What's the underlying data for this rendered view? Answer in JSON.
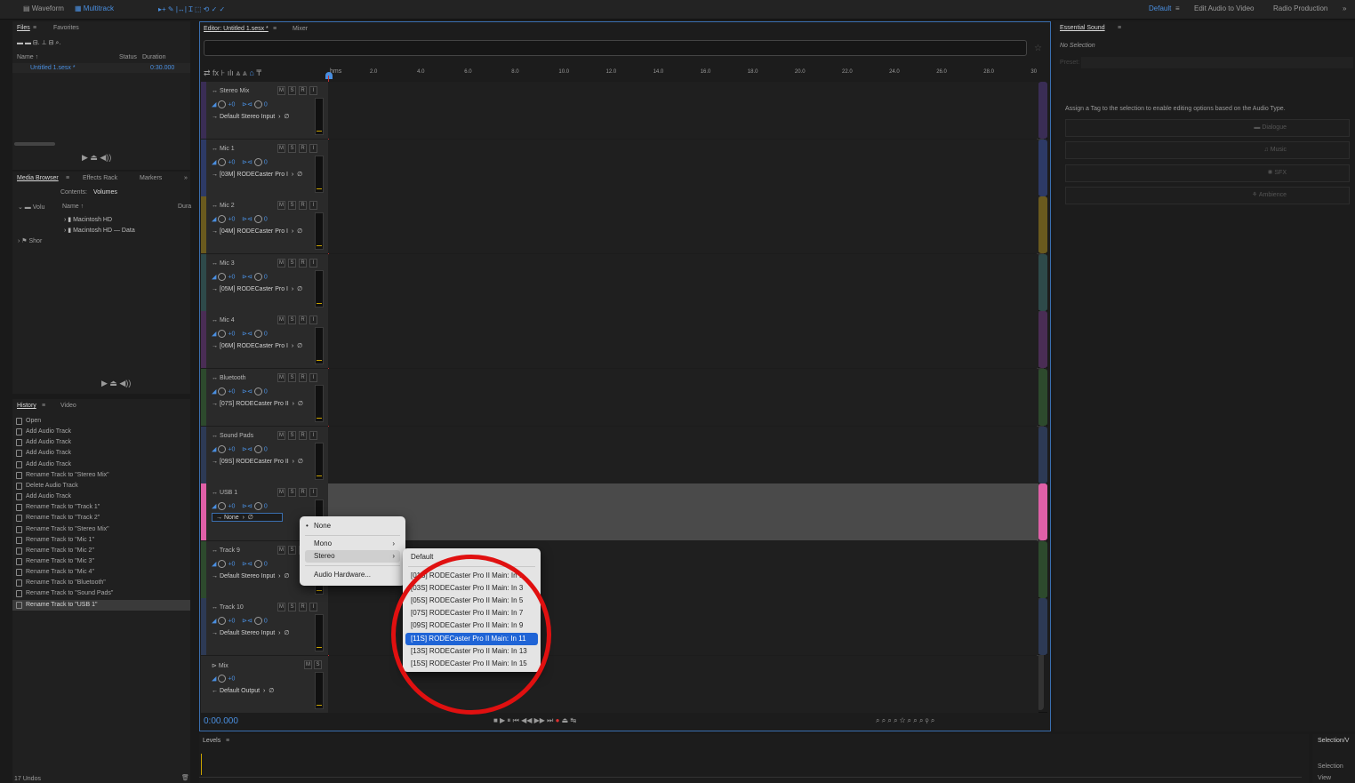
{
  "topbar": {
    "waveform": "Waveform",
    "multitrack": "Multitrack",
    "workspace_default": "Default",
    "edit_audio_to_video": "Edit Audio to Video",
    "radio_production": "Radio Production"
  },
  "files_panel": {
    "tab_files": "Files",
    "tab_favorites": "Favorites",
    "col_name": "Name ↑",
    "col_status": "Status",
    "col_duration": "Duration",
    "file_name": "Untitled 1.sesx *",
    "file_duration": "0:30.000"
  },
  "media_panel": {
    "tab_media": "Media Browser",
    "tab_effects": "Effects Rack",
    "tab_markers": "Markers",
    "contents_label": "Contents:",
    "contents_value": "Volumes",
    "col_name": "Name ↑",
    "col_dura": "Dura",
    "tree_volumes": "Volu",
    "tree_shortcuts": "Shor",
    "item1": "Macintosh HD",
    "item2": "Macintosh HD — Data"
  },
  "history_panel": {
    "tab_history": "History",
    "tab_video": "Video",
    "items": [
      "Open",
      "Add Audio Track",
      "Add Audio Track",
      "Add Audio Track",
      "Add Audio Track",
      "Rename Track to \"Stereo Mix\"",
      "Delete Audio Track",
      "Add Audio Track",
      "Rename Track to \"Track 1\"",
      "Rename Track to \"Track 2\"",
      "Rename Track to \"Stereo Mix\"",
      "Rename Track to \"Mic 1\"",
      "Rename Track to \"Mic 2\"",
      "Rename Track to \"Mic 3\"",
      "Rename Track to \"Mic 4\"",
      "Rename Track to \"Bluetooth\"",
      "Rename Track to \"Sound Pads\"",
      "Rename Track to \"USB 1\""
    ],
    "undos": "17 Undos"
  },
  "editor": {
    "tab_editor": "Editor: Untitled 1.sesx *",
    "tab_mixer": "Mixer",
    "hms": "hms",
    "ruler": [
      "2.0",
      "4.0",
      "6.0",
      "8.0",
      "10.0",
      "12.0",
      "14.0",
      "16.0",
      "18.0",
      "20.0",
      "22.0",
      "24.0",
      "26.0",
      "28.0",
      "30"
    ],
    "timecode": "0:00.000",
    "msr_m": "M",
    "msr_s": "S",
    "msr_r": "R",
    "msr_i": "I",
    "vol": "+0",
    "pan": "0"
  },
  "tracks": [
    {
      "name": "Stereo Mix",
      "input": "Default Stereo Input",
      "color": "#3a2d55"
    },
    {
      "name": "Mic 1",
      "input": "[03M] RODECaster Pro I",
      "color": "#2d3a66"
    },
    {
      "name": "Mic 2",
      "input": "[04M] RODECaster Pro I",
      "color": "#6a5a1e"
    },
    {
      "name": "Mic 3",
      "input": "[05M] RODECaster Pro I",
      "color": "#2e4a4a"
    },
    {
      "name": "Mic 4",
      "input": "[06M] RODECaster Pro I",
      "color": "#4a2d55"
    },
    {
      "name": "Bluetooth",
      "input": "[07S] RODECaster Pro II",
      "color": "#2d4a2d"
    },
    {
      "name": "Sound Pads",
      "input": "[09S] RODECaster Pro II",
      "color": "#2d3a55"
    },
    {
      "name": "USB 1",
      "input": "None",
      "color": "#e060a8"
    },
    {
      "name": "Track 9",
      "input": "Default Stereo Input",
      "color": "#2d4a2d"
    },
    {
      "name": "Track 10",
      "input": "Default Stereo Input",
      "color": "#2d3a55"
    },
    {
      "name": "Mix",
      "input": "Default Output",
      "color": "#2a2a2a"
    }
  ],
  "menu1": {
    "none": "None",
    "mono": "Mono",
    "stereo": "Stereo",
    "hardware": "Audio Hardware..."
  },
  "menu2": {
    "items": [
      "Default",
      "[01S] RODECaster Pro II Main: In 1",
      "[03S] RODECaster Pro II Main: In 3",
      "[05S] RODECaster Pro II Main: In 5",
      "[07S] RODECaster Pro II Main: In 7",
      "[09S] RODECaster Pro II Main: In 9",
      "[11S] RODECaster Pro II Main: In 11",
      "[13S] RODECaster Pro II Main: In 13",
      "[15S] RODECaster Pro II Main: In 15"
    ]
  },
  "essential": {
    "title": "Essential Sound",
    "no_selection": "No Selection",
    "preset": "Preset:",
    "assign_text": "Assign a Tag to the selection to enable editing options based on the Audio Type.",
    "dialogue": "Dialogue",
    "music": "Music",
    "sfx": "SFX",
    "ambience": "Ambience"
  },
  "levels": {
    "title": "Levels"
  },
  "selview": {
    "title": "Selection/V",
    "selection": "Selection",
    "view": "View"
  },
  "colors": {
    "accent": "#4a8fe0",
    "highlight_circle": "#e01010",
    "menu_highlight": "#1f64d6"
  }
}
